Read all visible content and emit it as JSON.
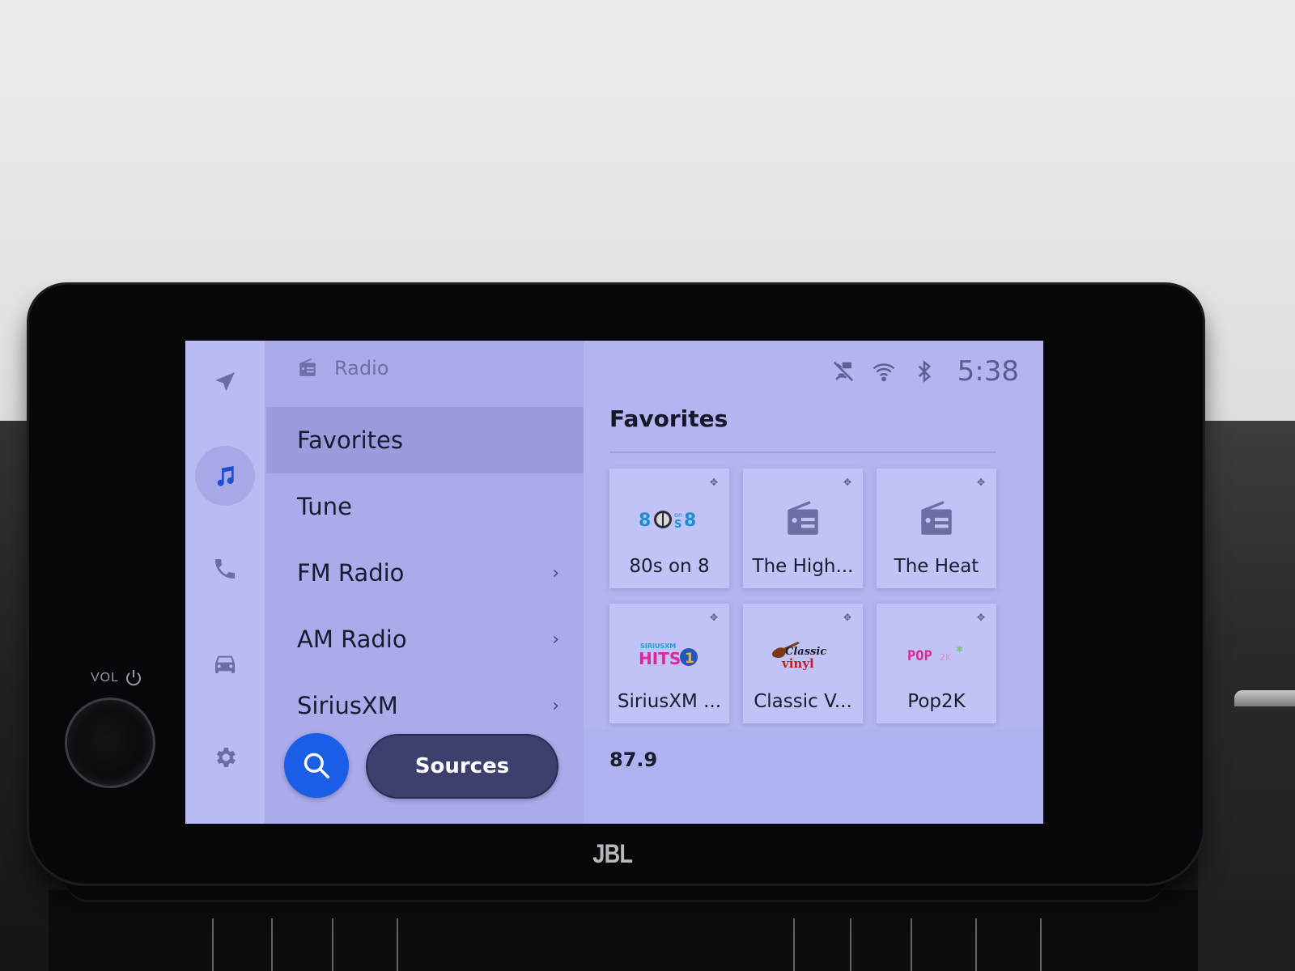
{
  "hardware": {
    "volume_label": "VOL",
    "brand_logo": "JBL"
  },
  "rail": {
    "items": [
      {
        "name": "navigation",
        "icon": "navigation-arrow-icon",
        "active": false
      },
      {
        "name": "media",
        "icon": "music-note-icon",
        "active": true
      },
      {
        "name": "phone",
        "icon": "phone-icon",
        "active": false
      },
      {
        "name": "vehicle",
        "icon": "car-icon",
        "active": false
      },
      {
        "name": "settings",
        "icon": "gear-icon",
        "active": false
      }
    ]
  },
  "menu": {
    "header_icon": "radio-icon",
    "header_title": "Radio",
    "items": [
      {
        "label": "Favorites",
        "selected": true,
        "has_submenu": false
      },
      {
        "label": "Tune",
        "selected": false,
        "has_submenu": false
      },
      {
        "label": "FM Radio",
        "selected": false,
        "has_submenu": true
      },
      {
        "label": "AM Radio",
        "selected": false,
        "has_submenu": true
      },
      {
        "label": "SiriusXM",
        "selected": false,
        "has_submenu": true
      }
    ],
    "chevron": "›",
    "search_icon": "search-icon",
    "sources_label": "Sources"
  },
  "status_bar": {
    "icons": [
      "satellite-off-icon",
      "wifi-icon",
      "bluetooth-icon"
    ],
    "time": "5:38"
  },
  "main": {
    "title": "Favorites",
    "tiles": [
      {
        "label": "80s on 8",
        "logo_text": "80s on 8",
        "logo_type": "channel-logo"
      },
      {
        "label": "The High...",
        "logo_text": "",
        "logo_type": "radio-icon"
      },
      {
        "label": "The Heat",
        "logo_text": "",
        "logo_type": "radio-icon"
      },
      {
        "label": "SiriusXM ...",
        "logo_text": "SiriusXM Hits 1",
        "logo_type": "channel-logo"
      },
      {
        "label": "Classic V...",
        "logo_text": "Classic vinyl",
        "logo_type": "channel-logo"
      },
      {
        "label": "Pop2K",
        "logo_text": "POP2K",
        "logo_type": "channel-logo"
      }
    ],
    "now_playing": "87.9"
  },
  "colors": {
    "accent": "#1a5ee8",
    "sources_button": "#3d3f6e",
    "selected_row": "#9b9cdd",
    "screen_bg": "#b3b5ef"
  }
}
